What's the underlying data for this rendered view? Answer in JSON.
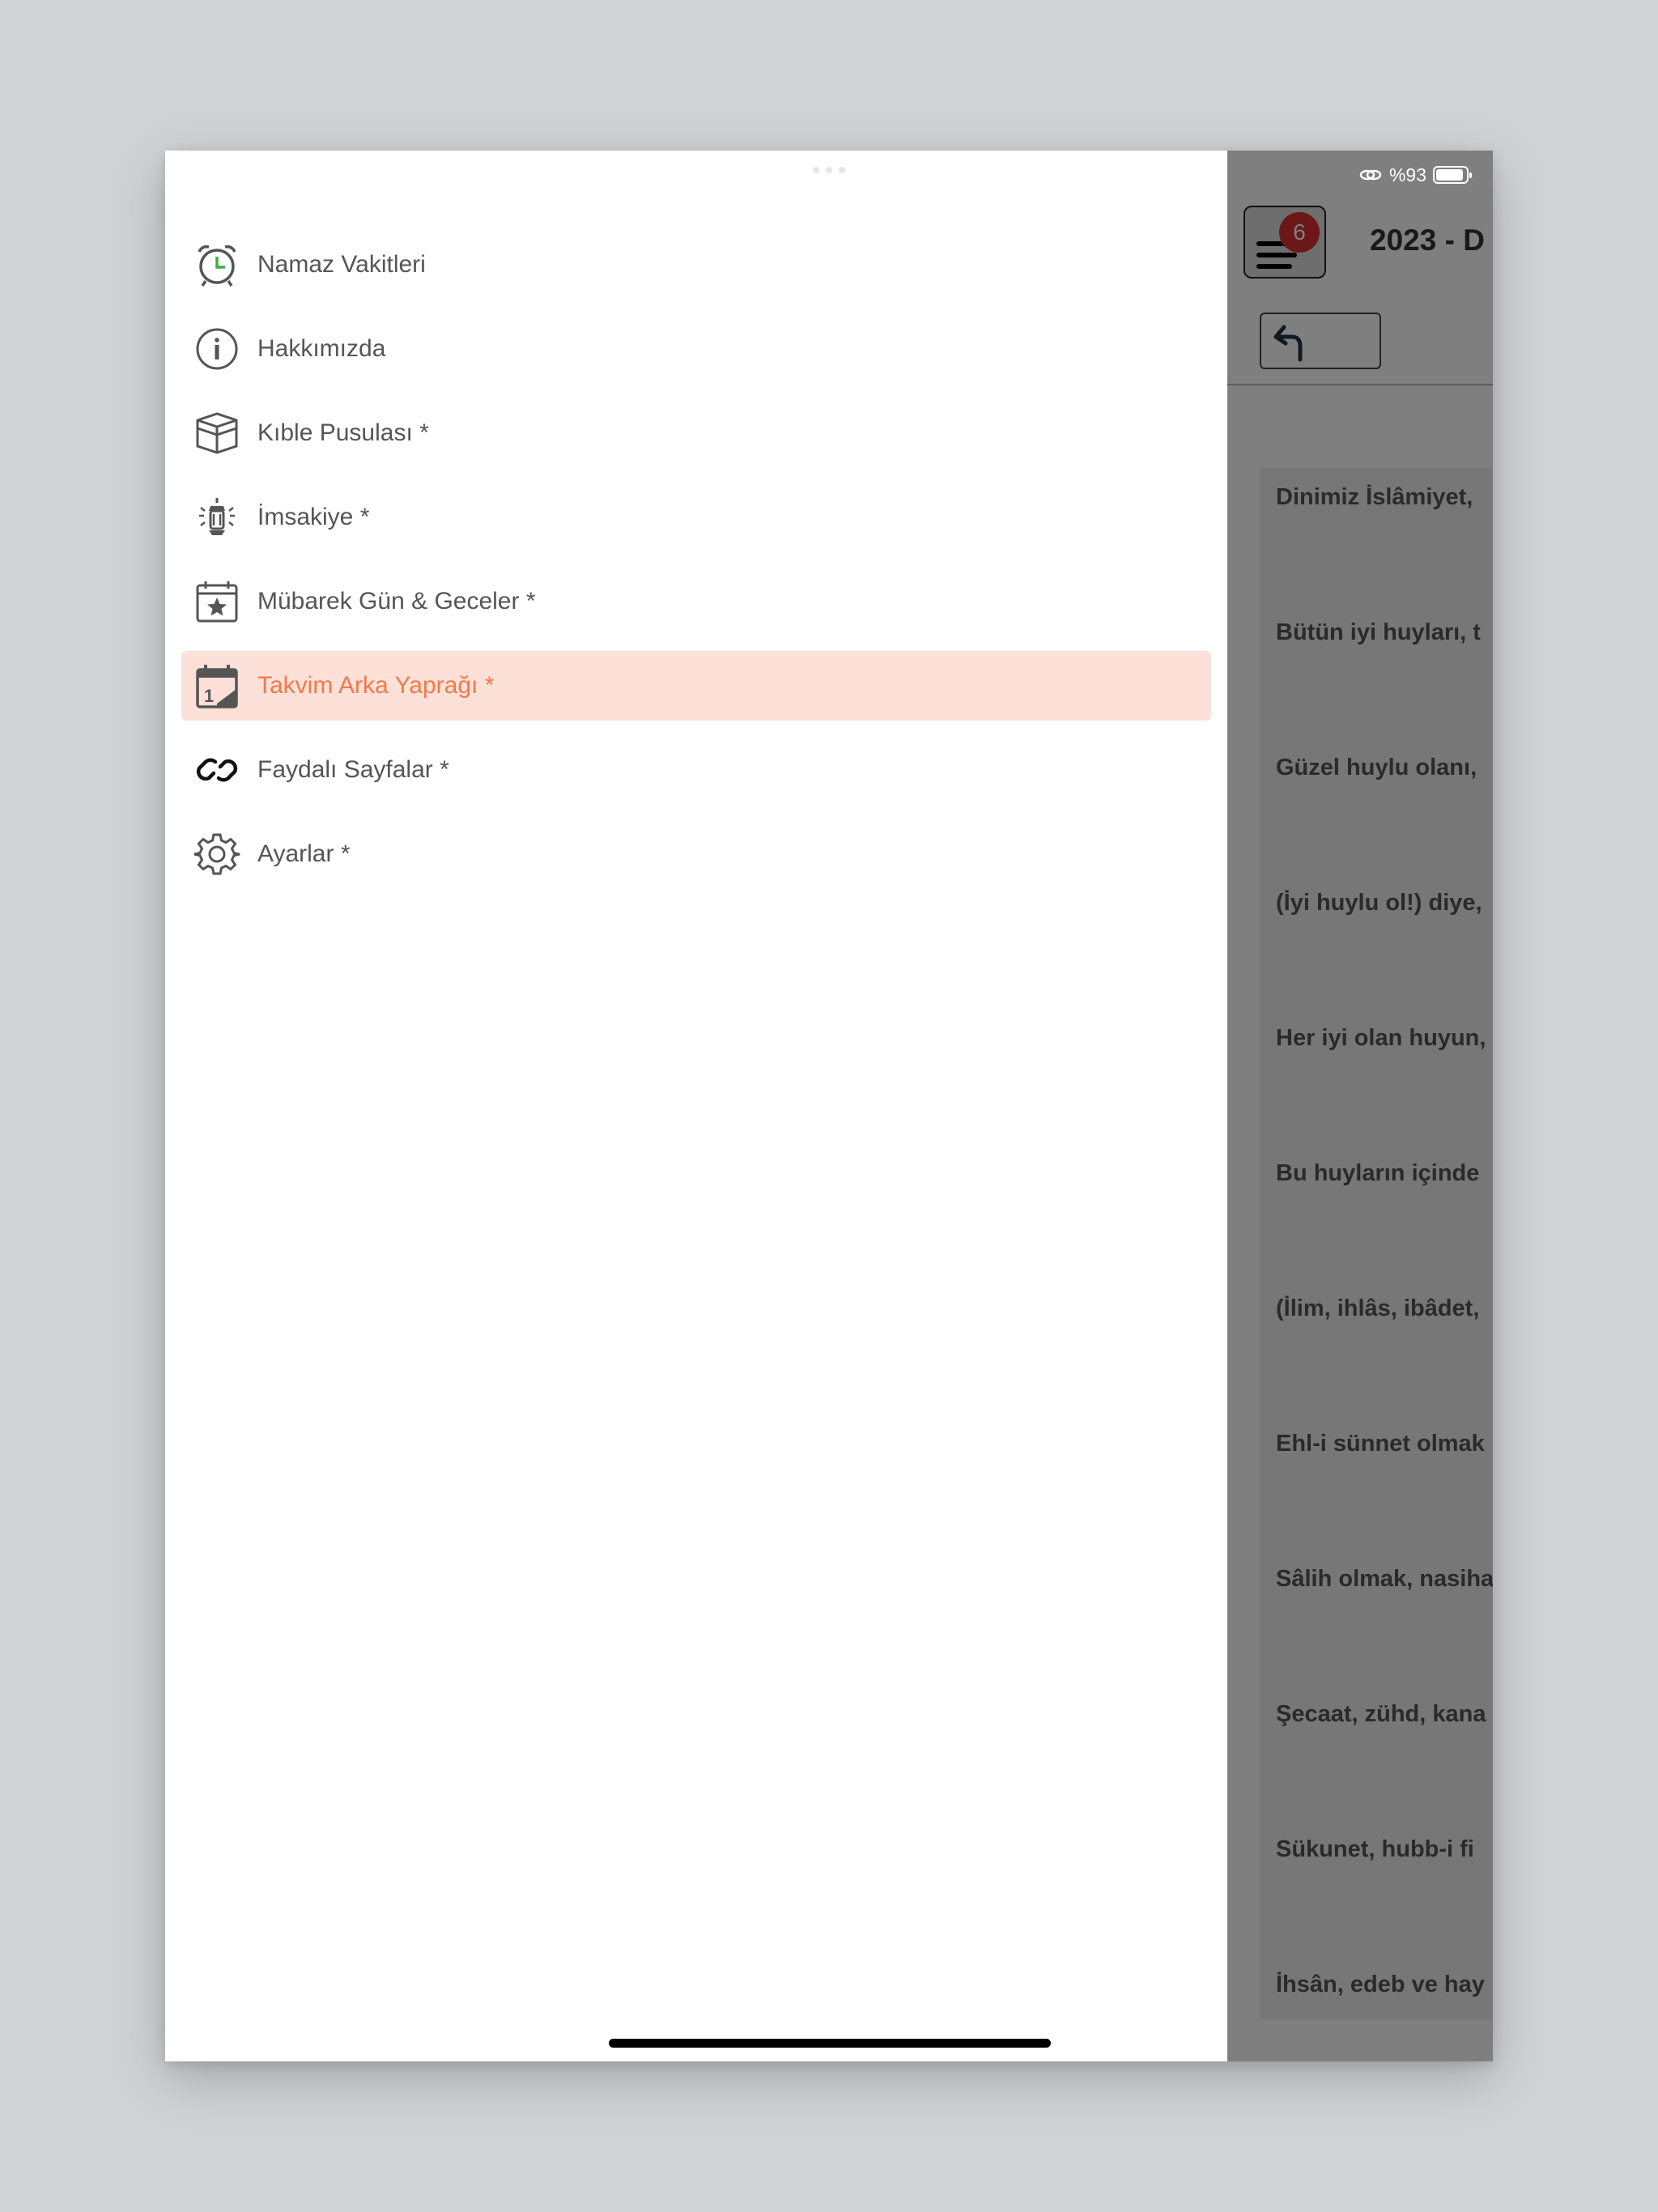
{
  "status": {
    "battery_text": "%93",
    "battery_level": 0.93
  },
  "header": {
    "badge_count": "6",
    "title": "2023 - D"
  },
  "content_lines": [
    "Dinimiz İslâmiyet,",
    "Bütün iyi huyları, t",
    "Güzel huylu olanı,",
    "(İyi huylu ol!) diye,",
    "Her iyi olan huyun,",
    "Bu huyların içinde",
    "(İlim, ihlâs, ibâdet,",
    "Ehl-i sünnet olmak",
    "Sâlih olmak, nasiha",
    "Şecaat, zühd, kana",
    "Sükunet, hubb-i fi",
    "İhsân, edeb ve hay"
  ],
  "drawer": {
    "items": [
      {
        "label": "Namaz Vakitleri",
        "icon": "alarm-clock-icon"
      },
      {
        "label": "Hakkımızda",
        "icon": "info-icon"
      },
      {
        "label": "Kıble Pusulası *",
        "icon": "kaaba-icon"
      },
      {
        "label": "İmsakiye *",
        "icon": "lantern-icon"
      },
      {
        "label": "Mübarek Gün & Geceler *",
        "icon": "calendar-star-icon"
      },
      {
        "label": "Takvim Arka Yaprağı *",
        "icon": "calendar-page-icon",
        "active": true
      },
      {
        "label": "Faydalı Sayfalar *",
        "icon": "link-icon"
      },
      {
        "label": "Ayarlar *",
        "icon": "gear-icon"
      }
    ]
  },
  "colors": {
    "accent": "#f27a4a",
    "active_bg": "#fde0d8",
    "badge": "#d93030",
    "clock_hands": "#3cb043"
  }
}
